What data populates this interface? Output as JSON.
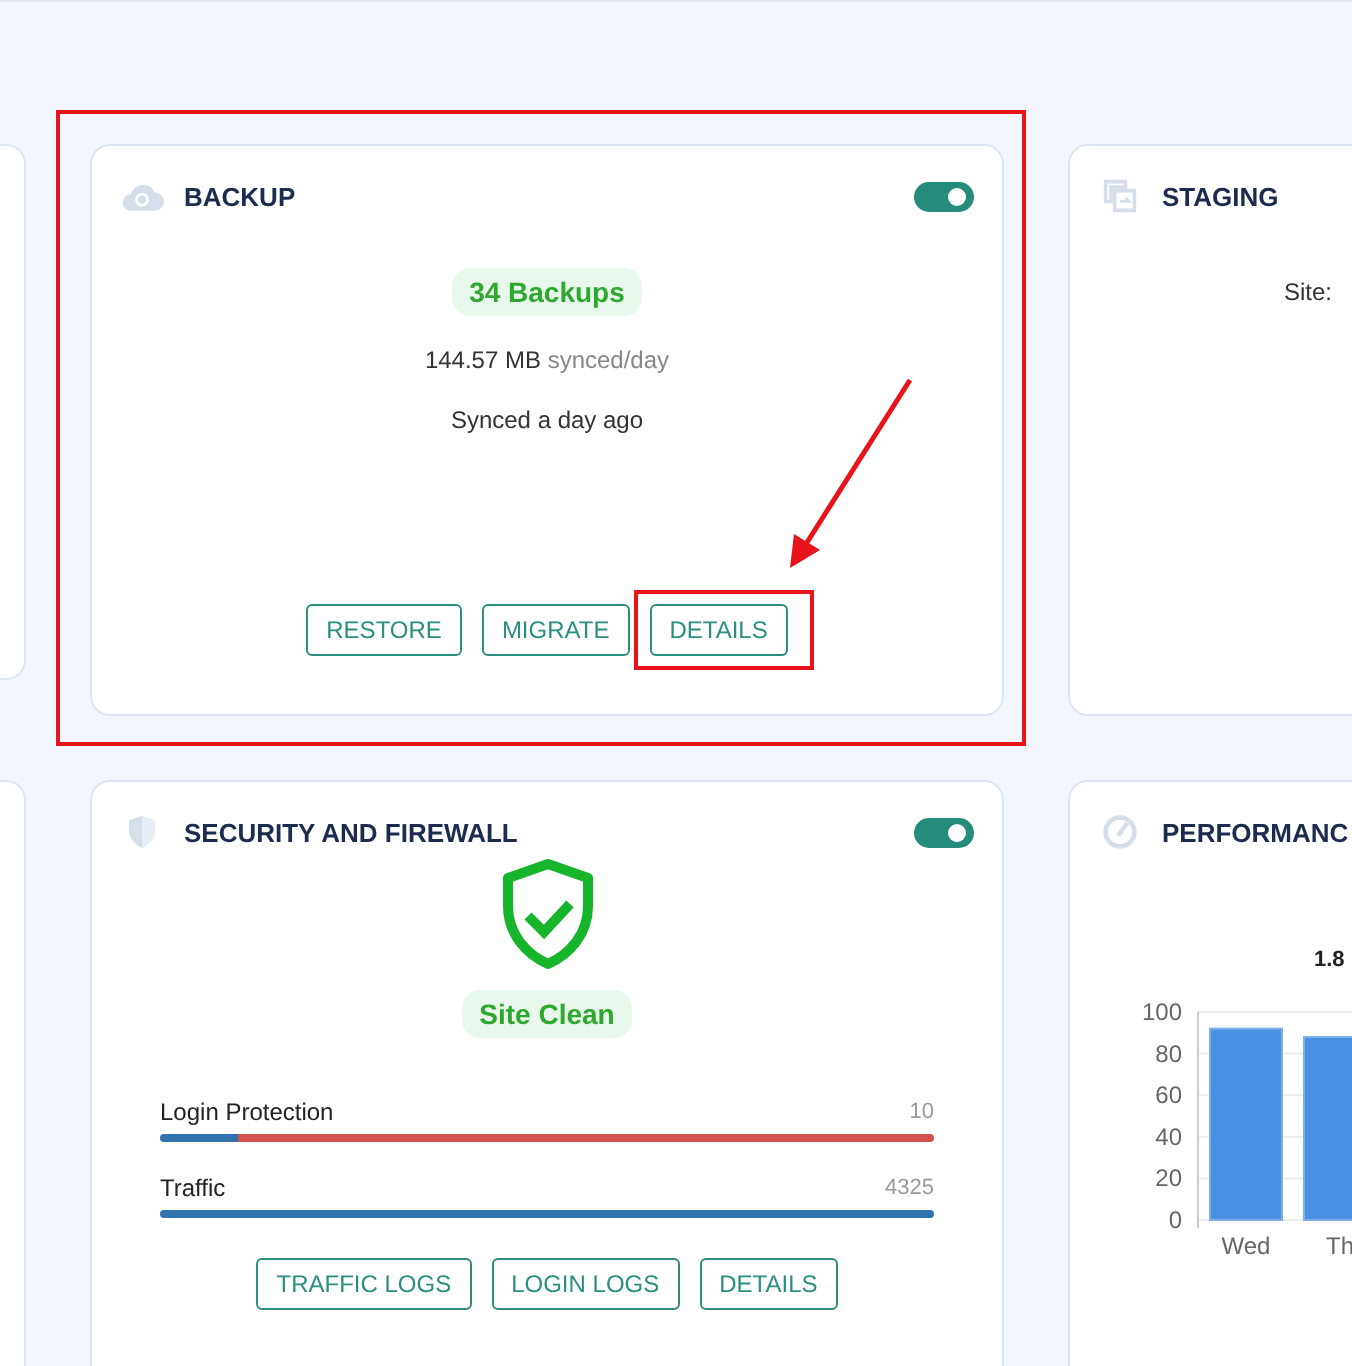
{
  "backup": {
    "title": "BACKUP",
    "toggle_on": true,
    "badge": "34 Backups",
    "size": "144.57 MB",
    "size_unit": "synced/day",
    "synced": "Synced a day ago",
    "buttons": [
      "RESTORE",
      "MIGRATE",
      "DETAILS"
    ]
  },
  "staging": {
    "title": "STAGING",
    "site_label": "Site:"
  },
  "security": {
    "title": "SECURITY AND FIREWALL",
    "toggle_on": true,
    "badge": "Site Clean",
    "meters": [
      {
        "label": "Login Protection",
        "reading": "10",
        "level": 0.1,
        "kind": "split"
      },
      {
        "label": "Traffic",
        "reading": "4325",
        "kind": "full"
      }
    ],
    "buttons": [
      "TRAFFIC LOGS",
      "LOGIN LOGS",
      "DETAILS"
    ]
  },
  "performance": {
    "title": "PERFORMANC",
    "chart_data": {
      "type": "bar",
      "title": "1.8",
      "categories": [
        "Wed",
        "Th"
      ],
      "series": [
        {
          "color": "#4a90e2",
          "values": [
            92,
            88
          ]
        }
      ],
      "ylim": [
        0,
        100
      ],
      "yticks": [
        0,
        20,
        40,
        60,
        80,
        100
      ],
      "grid": true
    }
  }
}
